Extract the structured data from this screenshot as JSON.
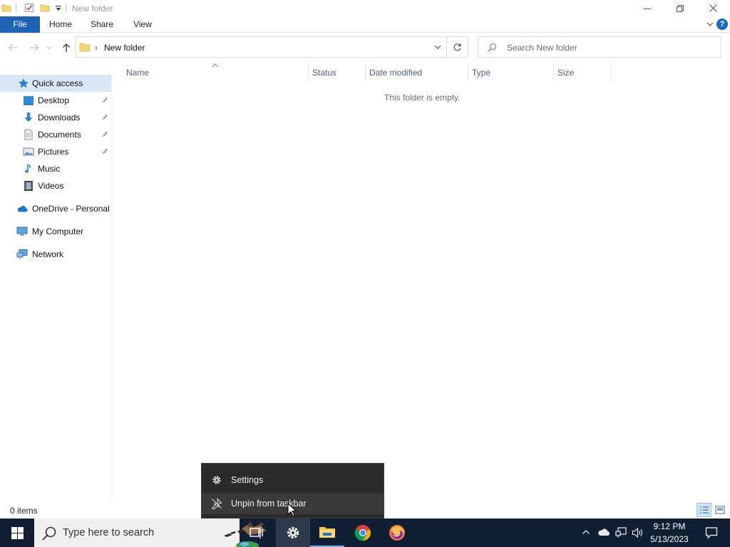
{
  "window": {
    "title": "New folder",
    "tabs": {
      "file": "File",
      "home": "Home",
      "share": "Share",
      "view": "View"
    }
  },
  "address": {
    "path": "New folder",
    "search_placeholder": "Search New folder"
  },
  "columns": {
    "name": "Name",
    "status": "Status",
    "date_modified": "Date modified",
    "type": "Type",
    "size": "Size"
  },
  "content": {
    "empty_message": "This folder is empty."
  },
  "nav": {
    "quick_access": "Quick access",
    "desktop": "Desktop",
    "downloads": "Downloads",
    "documents": "Documents",
    "pictures": "Pictures",
    "music": "Music",
    "videos": "Videos",
    "onedrive": "OneDrive - Personal",
    "my_computer": "My Computer",
    "network": "Network"
  },
  "status": {
    "item_count": "0 items"
  },
  "context_menu": {
    "settings": "Settings",
    "unpin": "Unpin from taskbar"
  },
  "taskbar": {
    "search_placeholder": "Type here to search",
    "time": "9:12 PM",
    "date": "5/13/2023"
  },
  "colors": {
    "file_tab": "#1f63b5",
    "taskbar": "#101f33",
    "context_menu": "#2b2b2b",
    "selection": "#d9e6f4"
  }
}
